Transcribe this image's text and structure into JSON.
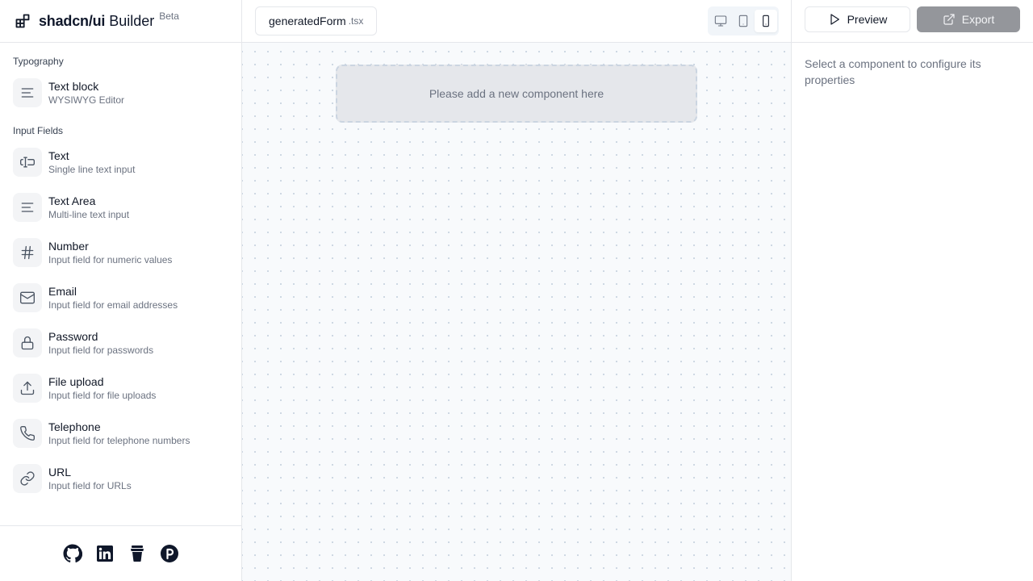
{
  "brand": {
    "name": "shadcn/ui",
    "sub": "Builder",
    "badge": "Beta"
  },
  "sidebar": {
    "sections": [
      {
        "title": "Typography",
        "items": [
          {
            "label": "Text block",
            "desc": "WYSIWYG Editor",
            "icon": "text-align-icon"
          }
        ]
      },
      {
        "title": "Input Fields",
        "items": [
          {
            "label": "Text",
            "desc": "Single line text input",
            "icon": "text-cursor-input-icon"
          },
          {
            "label": "Text Area",
            "desc": "Multi-line text input",
            "icon": "text-align-icon"
          },
          {
            "label": "Number",
            "desc": "Input field for numeric values",
            "icon": "hash-icon"
          },
          {
            "label": "Email",
            "desc": "Input field for email addresses",
            "icon": "mail-icon"
          },
          {
            "label": "Password",
            "desc": "Input field for passwords",
            "icon": "lock-icon"
          },
          {
            "label": "File upload",
            "desc": "Input field for file uploads",
            "icon": "upload-icon"
          },
          {
            "label": "Telephone",
            "desc": "Input field for telephone numbers",
            "icon": "phone-icon"
          },
          {
            "label": "URL",
            "desc": "Input field for URLs",
            "icon": "link-icon"
          }
        ]
      }
    ]
  },
  "footer": {
    "links": [
      "github-icon",
      "linkedin-icon",
      "coffee-cup-icon",
      "patreon-icon"
    ]
  },
  "canvas": {
    "file_name": "generatedForm",
    "file_ext": ".tsx",
    "devices": [
      "desktop-icon",
      "tablet-icon",
      "mobile-icon"
    ],
    "active_device": "mobile",
    "dropzone_text": "Please add a new component here"
  },
  "panel": {
    "preview_label": "Preview",
    "export_label": "Export",
    "hint": "Select a component to configure its properties"
  }
}
